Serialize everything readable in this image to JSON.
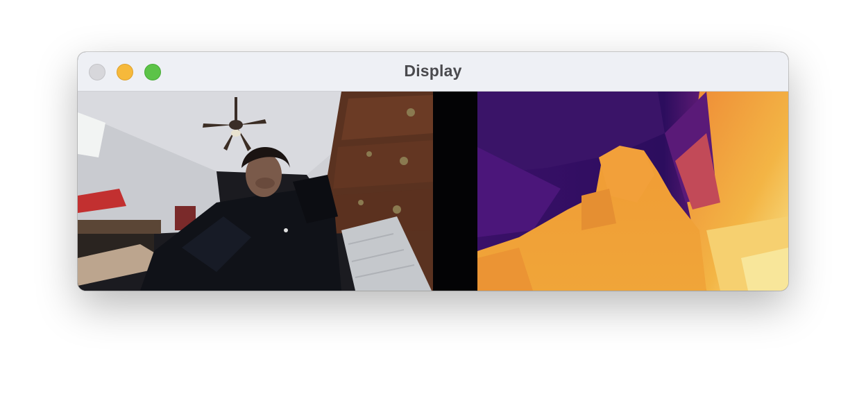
{
  "window": {
    "title": "Display",
    "controls": {
      "close_color": "#d7d7db",
      "minimize_color": "#f6b93b",
      "maximize_color": "#5cc348"
    }
  },
  "panels": {
    "left": "camera",
    "right": "depth"
  },
  "colors": {
    "titlebar_bg": "#eef0f5",
    "title_text": "#4a4a4e",
    "depth_near": "#f7e08a",
    "depth_mid": "#f0a030",
    "depth_far": "#3a0f6e"
  }
}
